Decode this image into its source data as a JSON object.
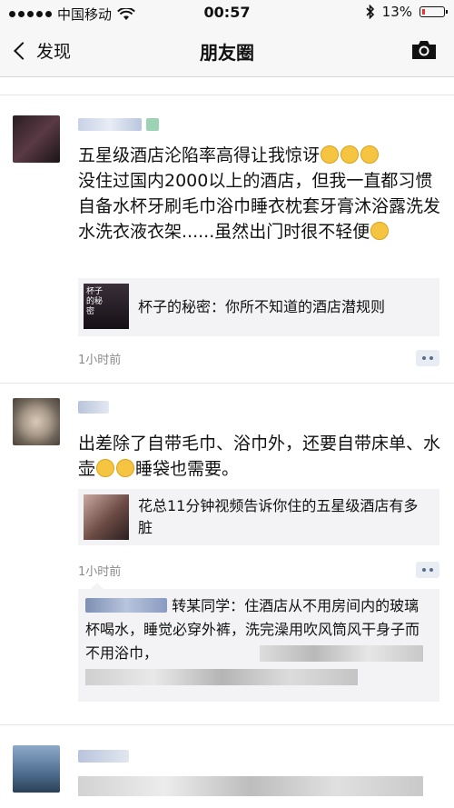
{
  "status": {
    "carrier": "中国移动",
    "time": "00:57",
    "battery": "13%"
  },
  "nav": {
    "back_label": "发现",
    "title": "朋友圈"
  },
  "posts": [
    {
      "text": "五星级酒店沦陷率高得让我惊讶",
      "text2": "没住过国内2000以上的酒店，但我一直都习惯自备水杯牙刷毛巾浴巾睡衣枕套牙膏沐浴露洗发水洗衣液衣架......虽然出门时很不轻便",
      "card": "杯子的秘密：你所不知道的酒店潜规则",
      "thumb_text": "杯子的秘密",
      "time": "1小时前"
    },
    {
      "text": "出差除了自带毛巾、浴巾外，还要自带床单、水壶",
      "text2": "睡袋也需要。",
      "card": "花总11分钟视频告诉你住的五星级酒店有多脏",
      "time": "1小时前",
      "comment": "转某同学：住酒店从不用房间内的玻璃杯喝水，睡觉必穿外裤，洗完澡用吹风筒风干身子而不用浴巾，"
    }
  ],
  "colors": {
    "accent": "#5b6b8c",
    "link_bg": "#f3f3f5"
  }
}
